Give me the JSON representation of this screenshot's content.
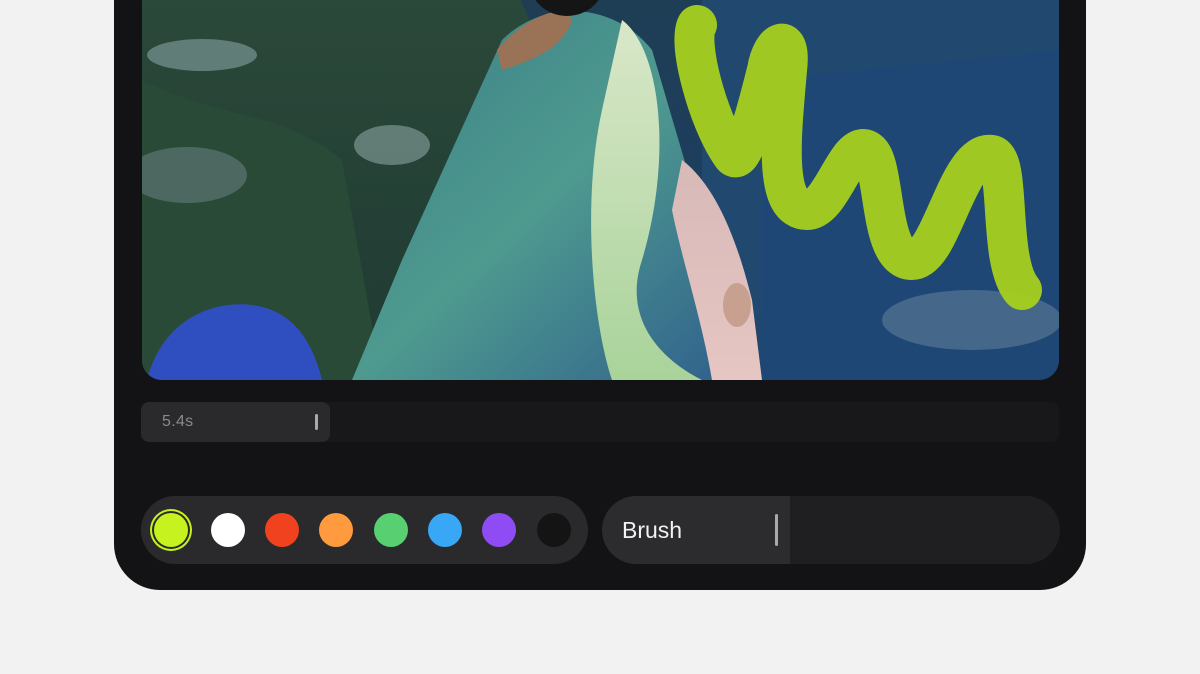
{
  "timeline": {
    "time_label": "5.4s"
  },
  "palette": {
    "selected": "lime",
    "swatches": [
      {
        "name": "lime",
        "color": "#c6f31f"
      },
      {
        "name": "white",
        "color": "#ffffff"
      },
      {
        "name": "red",
        "color": "#f1421f"
      },
      {
        "name": "orange",
        "color": "#ff9a3e"
      },
      {
        "name": "green",
        "color": "#58cf71"
      },
      {
        "name": "blue",
        "color": "#37a7f6"
      },
      {
        "name": "purple",
        "color": "#8f4cf5"
      },
      {
        "name": "black",
        "color": "#141414"
      }
    ]
  },
  "tool": {
    "label": "Brush"
  },
  "stroke_color": "#a6d11e"
}
